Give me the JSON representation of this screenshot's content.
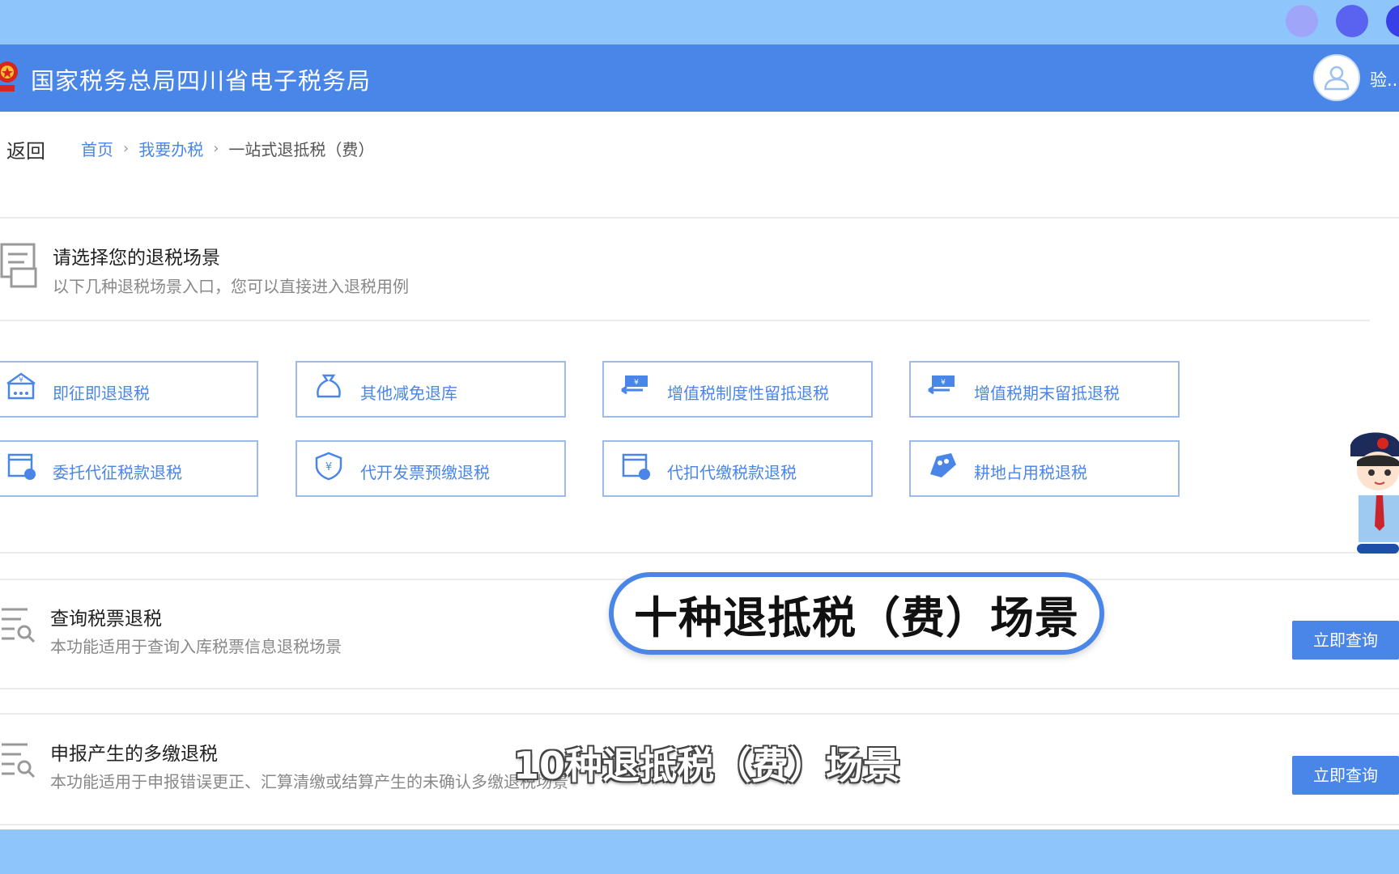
{
  "window": {
    "site_title": "国家税务总局四川省电子税务局",
    "user_name": "验..."
  },
  "nav": {
    "back_label": "返回",
    "breadcrumb": [
      "首页",
      "我要办税",
      "一站式退抵税（费）"
    ]
  },
  "scene_section": {
    "title": "请选择您的退税场景",
    "subtitle": "以下几种退税场景入口，您可以直接进入退税用例",
    "cards": [
      {
        "label": "即征即退退税",
        "icon": "tax-building-icon"
      },
      {
        "label": "其他减免退库",
        "icon": "money-bag-icon"
      },
      {
        "label": "增值税制度性留抵退税",
        "icon": "refund-exchange-icon"
      },
      {
        "label": "增值税期末留抵退税",
        "icon": "refund-exchange-icon"
      },
      {
        "label": "委托代征税款退税",
        "icon": "document-refresh-icon"
      },
      {
        "label": "代开发票预缴退税",
        "icon": "yuan-shield-icon"
      },
      {
        "label": "代扣代缴税款退税",
        "icon": "document-refresh-icon"
      },
      {
        "label": "耕地占用税退税",
        "icon": "land-icon"
      }
    ]
  },
  "query_sections": [
    {
      "title": "查询税票退税",
      "subtitle": "本功能适用于查询入库税票信息退税场景",
      "button": "立即查询"
    },
    {
      "title": "申报产生的多缴退税",
      "subtitle": "本功能适用于申报错误更正、汇算清缴或结算产生的未确认多缴退税场景",
      "button": "立即查询"
    }
  ],
  "overlay": {
    "callout": "十种退抵税（费）场景",
    "subtitle": "10种退抵税（费）场景"
  },
  "colors": {
    "header": "#4a86e8",
    "accent": "#4a86e8",
    "card_border": "#9dbbe8",
    "frame": "#8ec6fb"
  }
}
